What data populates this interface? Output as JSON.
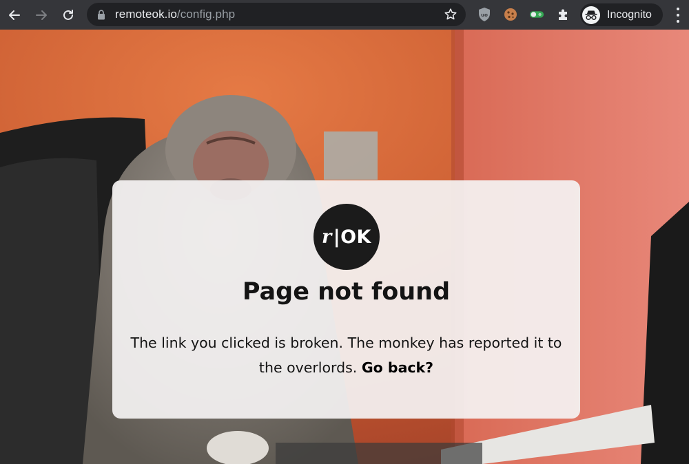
{
  "browser": {
    "url_host": "remoteok.io",
    "url_path": "/config.php",
    "profile_label": "Incognito",
    "icons": {
      "back": "back-arrow-icon",
      "forward": "forward-arrow-icon",
      "reload": "reload-icon",
      "lock": "lock-icon",
      "star": "star-icon",
      "extensions": [
        "ublock-icon",
        "cookie-icon",
        "toggle-icon",
        "puzzle-icon"
      ],
      "menu": "kebab-menu-icon"
    }
  },
  "page": {
    "logo_r": "r",
    "logo_ok": "|OK",
    "title": "Page not found",
    "message": "The link you clicked is broken. The monkey has reported it to the overlords.",
    "go_back": "Go back?",
    "colors": {
      "card_bg": "#f4f2f2",
      "logo_bg": "#1b1b1b",
      "wall": "#c9582f"
    }
  }
}
